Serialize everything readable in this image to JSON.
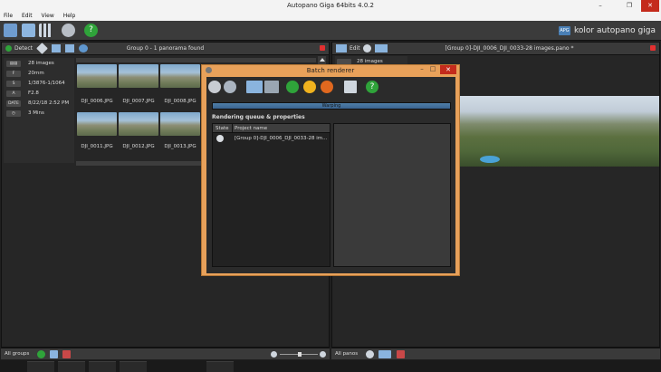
{
  "window": {
    "title": "Autopano Giga 64bits 4.0.2",
    "minimize": "–",
    "maximize": "❐",
    "close": "✕"
  },
  "menu": [
    "File",
    "Edit",
    "View",
    "Help"
  ],
  "brand": {
    "logo": "APG",
    "text": "kolor autopano giga"
  },
  "left_panel": {
    "detect_label": "Detect",
    "header_title": "Group 0 - 1 panorama found",
    "info": [
      {
        "tag": "▤▤",
        "value": "28 images"
      },
      {
        "tag": "F",
        "value": "20mm"
      },
      {
        "tag": "S",
        "value": "1/3876-1/1064"
      },
      {
        "tag": "A",
        "value": "F2.8"
      },
      {
        "tag": "DATE",
        "value": "8/22/18 2:52 PM"
      },
      {
        "tag": "◷",
        "value": "3 Mins"
      }
    ],
    "thumbnails_row1": [
      "DJI_0006.JPG",
      "DJI_0007.JPG",
      "DJI_0008.JPG"
    ],
    "thumbnails_row2": [
      "DJI_0011.JPG",
      "DJI_0012.JPG",
      "DJI_0013.JPG"
    ]
  },
  "right_panel": {
    "edit_label": "Edit",
    "header_title": "[Group 0]-DJI_0006_DJI_0033-28 images.pano *",
    "overlay_count": "28 images"
  },
  "dialog": {
    "title": "Batch renderer",
    "progress_text": "Warping",
    "progress_fraction": 1.0,
    "section_label": "Rendering queue & properties",
    "columns": [
      "State",
      "Project name"
    ],
    "rows": [
      {
        "name": "[Group 0]-DJI_0006_DJI_0033-28 im..."
      }
    ]
  },
  "bottom_left": {
    "label": "All groups"
  },
  "bottom_right": {
    "label": "All panos"
  },
  "colors": {
    "accent": "#e8a15a",
    "play": "#2fa33a",
    "pause": "#f0b21e",
    "stop": "#e0681f",
    "close_red": "#c42b1c"
  }
}
